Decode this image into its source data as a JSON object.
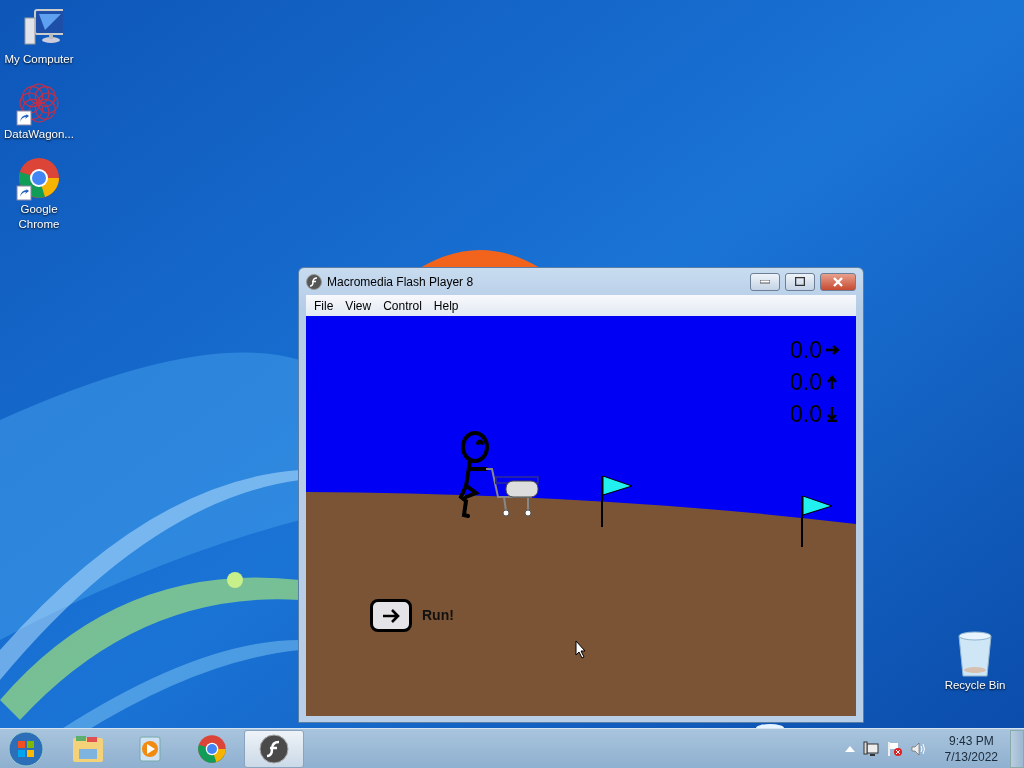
{
  "desktop_icons": [
    {
      "label": "My Computer",
      "kind": "computer",
      "shortcut": false
    },
    {
      "label": "DataWagon...",
      "kind": "datawagon",
      "shortcut": true
    },
    {
      "label": "Google Chrome",
      "kind": "chrome",
      "shortcut": true
    }
  ],
  "recycle_bin": {
    "label": "Recycle Bin"
  },
  "window": {
    "title": "Macromedia Flash Player 8",
    "menu": [
      "File",
      "View",
      "Control",
      "Help"
    ]
  },
  "game": {
    "stats": [
      {
        "value": "0.0",
        "kind": "right"
      },
      {
        "value": "0.0",
        "kind": "up"
      },
      {
        "value": "0.0",
        "kind": "down"
      }
    ],
    "run_label": "Run!"
  },
  "taskbar": {
    "apps": [
      {
        "kind": "explorer",
        "selected": false
      },
      {
        "kind": "media",
        "selected": false
      },
      {
        "kind": "chrome",
        "selected": false
      },
      {
        "kind": "flash",
        "selected": true
      }
    ],
    "time": "9:43 PM",
    "date": "7/13/2022"
  }
}
